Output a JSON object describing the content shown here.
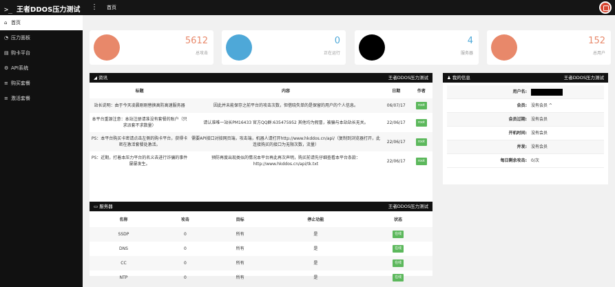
{
  "topbar": {
    "brand_prefix": ">_",
    "title": "王者DDOS压力测试",
    "menu_glyph": "⋮",
    "home_label": "首页"
  },
  "sidebar": {
    "items": [
      {
        "icon": "home-icon",
        "glyph": "⌂",
        "label": "首页",
        "active": true
      },
      {
        "icon": "dashboard-icon",
        "glyph": "◔",
        "label": "压力面板"
      },
      {
        "icon": "card-icon",
        "glyph": "▤",
        "label": "购卡平台"
      },
      {
        "icon": "code-icon",
        "glyph": "⚙",
        "label": "API系统"
      },
      {
        "icon": "cart-icon",
        "glyph": "≡",
        "label": "购买套餐"
      },
      {
        "icon": "activate-icon",
        "glyph": "≡",
        "label": "激活套餐"
      }
    ]
  },
  "stats": [
    {
      "icon": "chart-icon",
      "color": "#e8886a",
      "value": "5612",
      "label": "总攻击"
    },
    {
      "icon": "fire-icon",
      "color": "#4ea8d8",
      "value": "0",
      "label": "正在运行"
    },
    {
      "icon": "server-icon",
      "color": "#000000",
      "value": "4",
      "label": "服务器"
    },
    {
      "icon": "heart-icon",
      "color": "#e8886a",
      "value": "152",
      "label": "总用户"
    }
  ],
  "news": {
    "title": "资讯",
    "title_right": "王者DDOS压力测试",
    "headers": [
      "标题",
      "内容",
      "日期",
      "作者"
    ],
    "rows": [
      {
        "title": "站长说明：由于今天凌晨刚刚替换高防高速服务器",
        "content": "因此并未能保存之前平台的攻击次数，但借晓失单的是保留的用户的个人信息。",
        "date": "06/07/17",
        "author": "root"
      },
      {
        "title": "本平台重源注意：本站注册请准没有套餐的账户（只求派套不求数量）",
        "content": "请认准唯一站长PM16433 官方QQ群:635475952 其他均为假冒，被骗与本站站长无关。",
        "date": "22/06/17",
        "author": "root"
      },
      {
        "title": "PS：本平台购买卡密请点击左侧的购卡平台，获得卡密在激活套餐处激活。",
        "content": "需要API接口对接网页端，攻击端，机器人请打开http://www.hkddos.cn/api/（复制到浏览器打开，此连接购买的接口为无限次数，流量）",
        "date": "22/06/17",
        "author": "root"
      },
      {
        "title": "PS：近期，打着本压力平台的名义去进行诈骗的事件屡屡发生。",
        "content": "预防再度出现类似的情况本平台再此再次声明，购买前请先仔细查看本平台条款：http://www.hkddos.cn/api/tk.txt",
        "date": "22/06/17",
        "author": "root"
      }
    ]
  },
  "profile": {
    "title": "我的信息",
    "title_right": "王者DDOS压力测试",
    "rows": [
      {
        "key": "用户名:",
        "value": "",
        "masked": true
      },
      {
        "key": "会员:",
        "value": "没有会员 ^"
      },
      {
        "key": "会员过期:",
        "value": "没有会员"
      },
      {
        "key": "开机时间:",
        "value": "没有会员"
      },
      {
        "key": "并发:",
        "value": "没有会员"
      },
      {
        "key": "每日剩余攻击:",
        "value": "0/次"
      }
    ]
  },
  "servers": {
    "title": "服务器",
    "title_right": "王者DDOS压力测试",
    "headers": [
      "名称",
      "攻击",
      "目标",
      "停止功能",
      "状态"
    ],
    "rows": [
      {
        "name": "SSDP",
        "attacks": "0",
        "target": "所有",
        "stop": "是",
        "status": "在线"
      },
      {
        "name": "DNS",
        "attacks": "0",
        "target": "所有",
        "stop": "是",
        "status": "在线"
      },
      {
        "name": "CC",
        "attacks": "0",
        "target": "所有",
        "stop": "是",
        "status": "在线"
      },
      {
        "name": "NTP",
        "attacks": "0",
        "target": "所有",
        "stop": "是",
        "status": "在线"
      }
    ]
  }
}
